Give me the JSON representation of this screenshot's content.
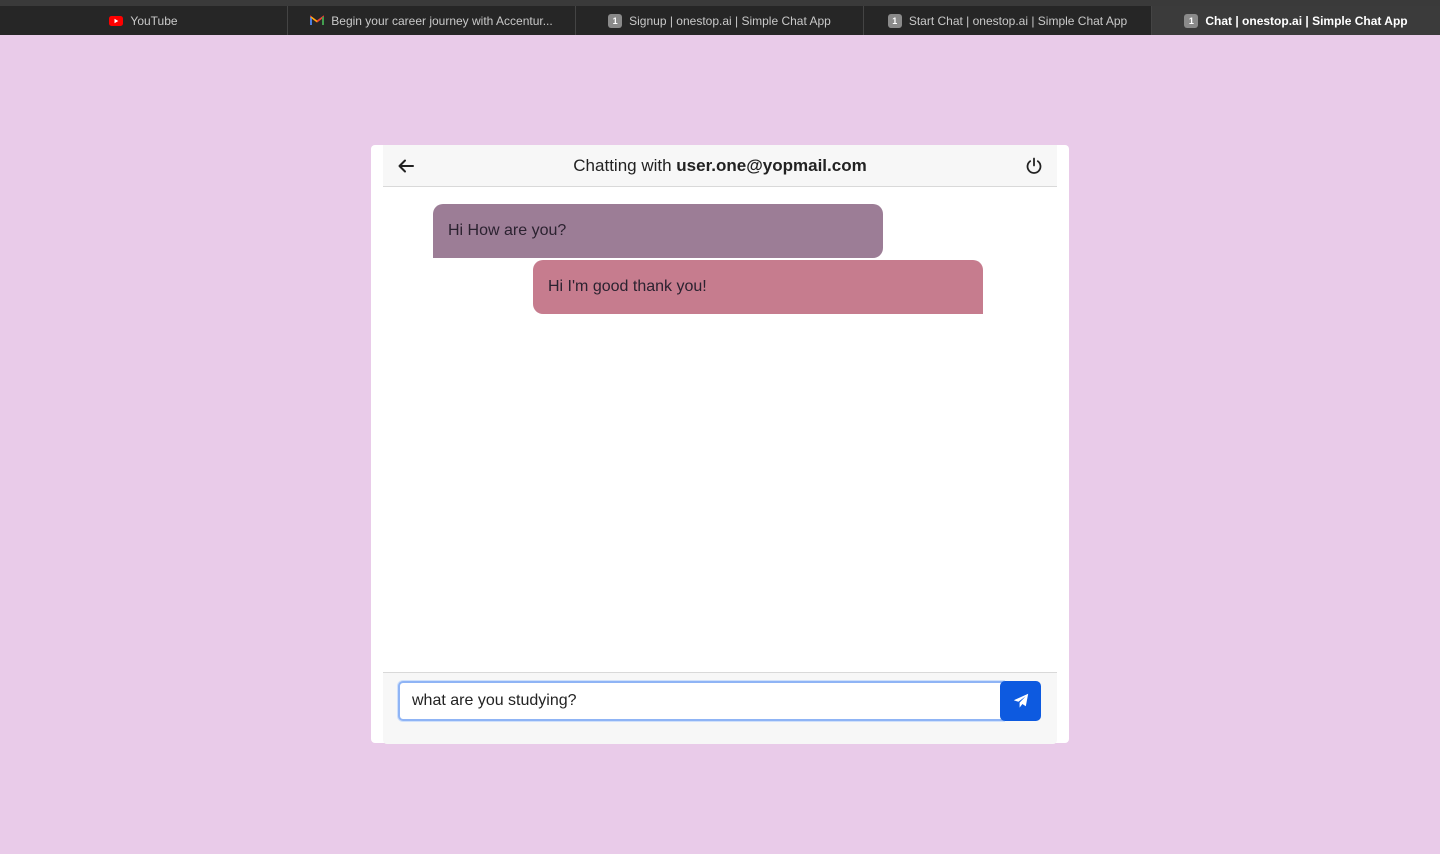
{
  "browser": {
    "tabs": [
      {
        "label": "YouTube",
        "icon": "youtube-icon",
        "active": false
      },
      {
        "label": "Begin your career journey with Accentur...",
        "icon": "gmail-icon",
        "active": false
      },
      {
        "label": "Signup | onestop.ai | Simple Chat App",
        "icon": "site-icon",
        "badge": "1",
        "active": false
      },
      {
        "label": "Start Chat | onestop.ai | Simple Chat App",
        "icon": "site-icon",
        "badge": "1",
        "active": false
      },
      {
        "label": "Chat | onestop.ai | Simple Chat App",
        "icon": "site-icon",
        "badge": "1",
        "active": true
      }
    ]
  },
  "chat": {
    "header": {
      "prefix": "Chatting with",
      "partner": "user.one@yopmail.com",
      "back_icon": "arrow-left-icon",
      "power_icon": "power-icon"
    },
    "messages": [
      {
        "text": "Hi How are you?",
        "direction": "received",
        "color": "#9c7d96"
      },
      {
        "text": "Hi I'm good thank you!",
        "direction": "sent",
        "color": "#c67c8e"
      }
    ],
    "composer": {
      "value": "what are you studying?",
      "send_icon": "paper-plane-icon",
      "send_color": "#0d5ae0"
    }
  },
  "colors": {
    "page_background": "#e9cbe9"
  }
}
